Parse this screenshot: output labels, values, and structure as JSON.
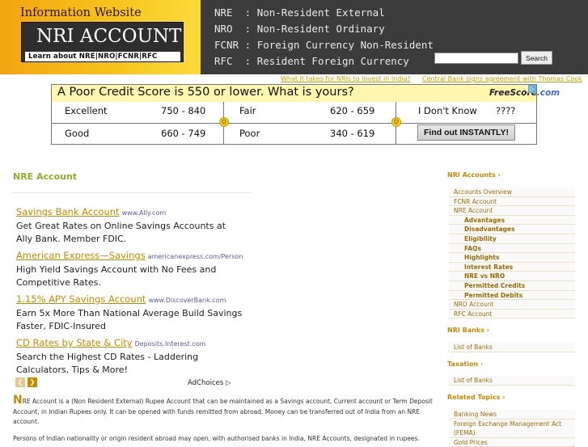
{
  "header": {
    "logo_tagline": "Information Website",
    "logo_main": "NRI ACCOUNT",
    "logo_sub": "Learn about NRE|NRO|FCNR|RFC",
    "abbreviations": [
      {
        "code": "NRE ",
        "meaning": ": Non-Resident External"
      },
      {
        "code": "NRO ",
        "meaning": ": Non-Resident Ordinary"
      },
      {
        "code": "FCNR",
        "meaning": ": Foreign Currency Non-Resident"
      },
      {
        "code": "RFC ",
        "meaning": ": Resident Foreign Currency"
      }
    ],
    "search_value": "",
    "search_button": "Search"
  },
  "top_links": [
    "What it takes for NRIs to invest in India?",
    "Central Bank signs agreement with Thomas Cook"
  ],
  "banner": {
    "title": "A Poor Credit Score is 550 or lower. What is yours?",
    "brand_a": "FreeScore",
    "brand_b": ".com",
    "rows": [
      [
        {
          "label": "Excellent",
          "range": "750 - 840"
        },
        {
          "label": "Fair",
          "range": "620 - 659"
        },
        {
          "label": "I Don't Know",
          "range": "????"
        }
      ],
      [
        {
          "label": "Good",
          "range": "660 - 749"
        },
        {
          "label": "Poor",
          "range": "340 - 619"
        }
      ]
    ],
    "cta": "Find out INSTANTLY!"
  },
  "main": {
    "title": "NRE Account",
    "ads": [
      {
        "title": "Savings Bank Account",
        "url": "www.Ally.com",
        "desc": "Get Great Rates on Online Savings Accounts at Ally Bank. Member FDIC."
      },
      {
        "title": "American Express—Savings",
        "url": "americanexpress.com/Person",
        "desc": "High Yield Savings Account with No Fees and Competitive Rates."
      },
      {
        "title": "1.15% APY Savings Account",
        "url": "www.DiscoverBank.com",
        "desc": "Earn 5x More Than National Average Build Savings Faster, FDIC-Insured"
      },
      {
        "title": "CD Rates by State & City",
        "url": "Deposits.Interest.com",
        "desc": "Search the Highest CD Rates - Laddering Calculators, Tips & More!"
      }
    ],
    "adchoices": "AdChoices",
    "dropcap": "N",
    "paragraph": "RE Account is a (Non Resident External) Rupee Account that can be maintained as a Savings account, Current account or Term Deposit Account, in Indian Rupees only. It can be opened with funds remitted from abroad. Money can be transferred out of India from an NRE account.",
    "paragraph2": "Persons of Indian nationality or origin resident abroad may open, with authorised banks in India, NRE Accounts, designated in rupees."
  },
  "sidebar": {
    "sections": [
      {
        "heading": "NRI Accounts",
        "items": [
          {
            "label": "Accounts Overview",
            "sub": false
          },
          {
            "label": "FCNR Account",
            "sub": false
          },
          {
            "label": "NRE Account",
            "sub": false
          },
          {
            "label": "Advantages",
            "sub": true
          },
          {
            "label": "Disadvantages",
            "sub": true
          },
          {
            "label": "Eligibility",
            "sub": true
          },
          {
            "label": "FAQs",
            "sub": true
          },
          {
            "label": "Highlights",
            "sub": true
          },
          {
            "label": "Interest Rates",
            "sub": true
          },
          {
            "label": "NRE vs NRO",
            "sub": true
          },
          {
            "label": "Permitted Credits",
            "sub": true
          },
          {
            "label": "Permitted Debits",
            "sub": true
          },
          {
            "label": "NRO Account",
            "sub": false
          },
          {
            "label": "RFC Account",
            "sub": false
          }
        ]
      },
      {
        "heading": "NRI Banks",
        "items": [
          {
            "label": "List of Banks",
            "sub": false
          }
        ]
      },
      {
        "heading": "Taxation",
        "items": [
          {
            "label": "List of Banks",
            "sub": false
          }
        ]
      },
      {
        "heading": "Related Topics",
        "items": [
          {
            "label": "Banking News",
            "sub": false
          },
          {
            "label": "Foreign Exchange Management Act",
            "sub": false
          },
          {
            "label": "(FEMA)",
            "sub": false
          },
          {
            "label": "Gold Prices",
            "sub": false
          }
        ]
      }
    ]
  }
}
